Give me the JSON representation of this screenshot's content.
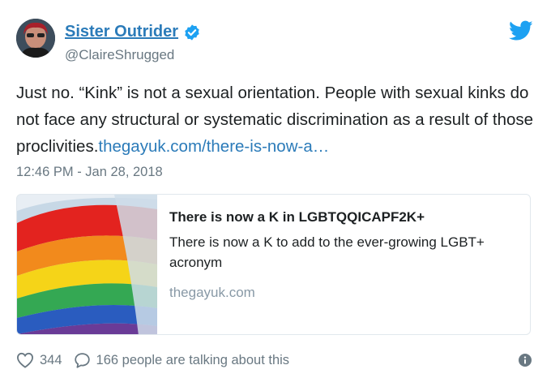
{
  "author": {
    "name": "Sister Outrider",
    "handle": "@ClaireShrugged"
  },
  "tweet": {
    "text": "Just no. “Kink” is not a sexual orientation. People with sexual kinks do not face any structural or systematic discrimination as a result of those proclivities.",
    "link": "thegayuk.com/there-is-now-a…",
    "timestamp": "12:46 PM - Jan 28, 2018"
  },
  "card": {
    "title": "There is now a K in LGBTQQICAPF2K+",
    "description": "There is now a K to add to the ever-growing LGBT+ acronym",
    "domain": "thegayuk.com"
  },
  "footer": {
    "likes": "344",
    "talking": "166 people are talking about this"
  },
  "colors": {
    "link": "#2b7bb9",
    "secondary_text": "#697882",
    "twitter_blue": "#1da1f2"
  },
  "icons": [
    "verified-badge-icon",
    "twitter-bird-icon",
    "heart-icon",
    "reply-bubble-icon",
    "info-icon"
  ]
}
